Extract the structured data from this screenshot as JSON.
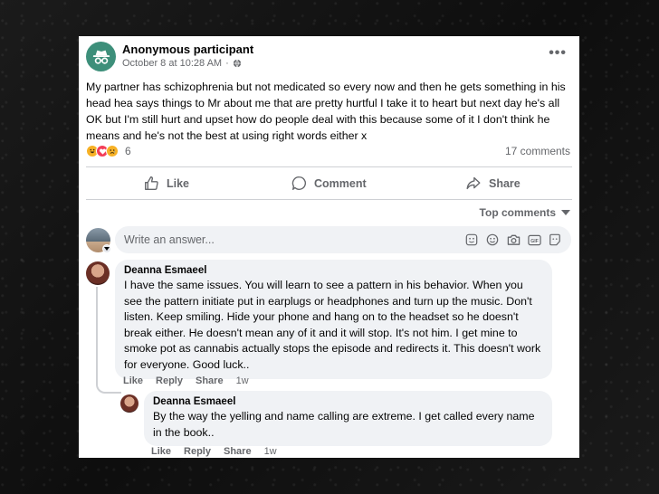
{
  "post": {
    "author": "Anonymous participant",
    "timestamp": "October 8 at 10:28 AM",
    "separator": "·",
    "privacy_icon": "globe-icon",
    "more_label": "•••",
    "body": "My partner has schizophrenia but not medicated so every now and then he gets something in his head hea says things to Mr about me that are pretty hurtful I take it to heart but next day he's all OK but I'm still hurt and upset how do people deal with this because some of it I don't think he means and he's not the best at using right words either x",
    "reaction_icons": [
      "haha-reaction-icon",
      "love-reaction-icon",
      "sad-reaction-icon"
    ],
    "reaction_count": "6",
    "comments_count": "17 comments"
  },
  "actions": {
    "like": "Like",
    "comment": "Comment",
    "share": "Share"
  },
  "sort": {
    "label": "Top comments"
  },
  "composer": {
    "placeholder": "Write an answer...",
    "icons": [
      "sticker-icon",
      "emoji-icon",
      "camera-icon",
      "gif-icon",
      "avatar-sticker-icon"
    ]
  },
  "comments": [
    {
      "name": "Deanna Esmaeel",
      "text": "I have the same issues. You will learn to see a pattern in his behavior. When you see the pattern initiate put in earplugs or headphones and turn up the music. Don't listen. Keep smiling. Hide your phone and hang on to the headset so he doesn't break either. He doesn't mean any of it and it will stop. It's not him. I get mine to smoke pot as cannabis actually stops the episode and redirects it. This doesn't work for everyone. Good luck..",
      "like": "Like",
      "reply": "Reply",
      "share": "Share",
      "time": "1w"
    },
    {
      "name": "Deanna Esmaeel",
      "text": "By the way the yelling and name calling are extreme. I get called every name in the book..",
      "like": "Like",
      "reply": "Reply",
      "share": "Share",
      "time": "1w"
    }
  ],
  "colors": {
    "card_bg": "#ffffff",
    "bubble_bg": "#f0f2f5",
    "secondary_text": "#65676b",
    "anon_avatar": "#3d8f7a"
  }
}
